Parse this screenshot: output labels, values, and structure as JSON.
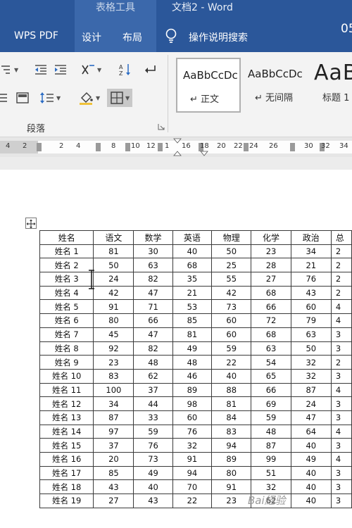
{
  "titlebar": {
    "context_tab": "表格工具",
    "doc_title": "文档2 - Word"
  },
  "tabs": [
    "WPS PDF",
    "设计",
    "布局"
  ],
  "tell_me": "操作说明搜索",
  "account_fragment": "05",
  "ribbon": {
    "group_label": "段落",
    "styles": [
      {
        "sample": "AaBbCcDc",
        "name": "正文"
      },
      {
        "sample": "AaBbCcDc",
        "name": "无间隔"
      },
      {
        "sample": "AaB",
        "name": "标题 1"
      }
    ]
  },
  "ruler": {
    "ticks": [
      "4",
      "2",
      "2",
      "4",
      "8",
      "10",
      "12",
      "1",
      "16",
      "18",
      "20",
      "22",
      "24",
      "26",
      "30",
      "32",
      "34"
    ]
  },
  "table": {
    "headers": [
      "姓名",
      "语文",
      "数学",
      "英语",
      "物理",
      "化学",
      "政治",
      "总"
    ],
    "rows": [
      [
        "姓名 1",
        "81",
        "30",
        "40",
        "50",
        "23",
        "34",
        "2"
      ],
      [
        "姓名 2",
        "50",
        "63",
        "68",
        "25",
        "28",
        "21",
        "2"
      ],
      [
        "姓名 3",
        "24",
        "82",
        "35",
        "55",
        "27",
        "76",
        "2"
      ],
      [
        "姓名 4",
        "42",
        "47",
        "21",
        "42",
        "68",
        "43",
        "2"
      ],
      [
        "姓名 5",
        "91",
        "71",
        "53",
        "73",
        "66",
        "60",
        "4"
      ],
      [
        "姓名 6",
        "80",
        "66",
        "85",
        "60",
        "72",
        "79",
        "4"
      ],
      [
        "姓名 7",
        "45",
        "47",
        "81",
        "60",
        "68",
        "63",
        "3"
      ],
      [
        "姓名 8",
        "92",
        "82",
        "49",
        "59",
        "63",
        "50",
        "3"
      ],
      [
        "姓名 9",
        "23",
        "48",
        "48",
        "22",
        "54",
        "32",
        "2"
      ],
      [
        "姓名 10",
        "83",
        "62",
        "46",
        "40",
        "65",
        "32",
        "3"
      ],
      [
        "姓名 11",
        "100",
        "37",
        "89",
        "88",
        "66",
        "87",
        "4"
      ],
      [
        "姓名 12",
        "34",
        "44",
        "98",
        "81",
        "69",
        "24",
        "3"
      ],
      [
        "姓名 13",
        "87",
        "33",
        "60",
        "84",
        "59",
        "47",
        "3"
      ],
      [
        "姓名 14",
        "97",
        "59",
        "76",
        "83",
        "48",
        "64",
        "4"
      ],
      [
        "姓名 15",
        "37",
        "76",
        "32",
        "94",
        "87",
        "40",
        "3"
      ],
      [
        "姓名 16",
        "20",
        "73",
        "91",
        "89",
        "99",
        "49",
        "4"
      ],
      [
        "姓名 17",
        "85",
        "49",
        "94",
        "80",
        "51",
        "40",
        "3"
      ],
      [
        "姓名 18",
        "43",
        "40",
        "70",
        "91",
        "32",
        "40",
        "3"
      ],
      [
        "姓名 19",
        "27",
        "43",
        "22",
        "23",
        "62",
        "40",
        "3"
      ]
    ]
  },
  "watermark": "Bai経验"
}
